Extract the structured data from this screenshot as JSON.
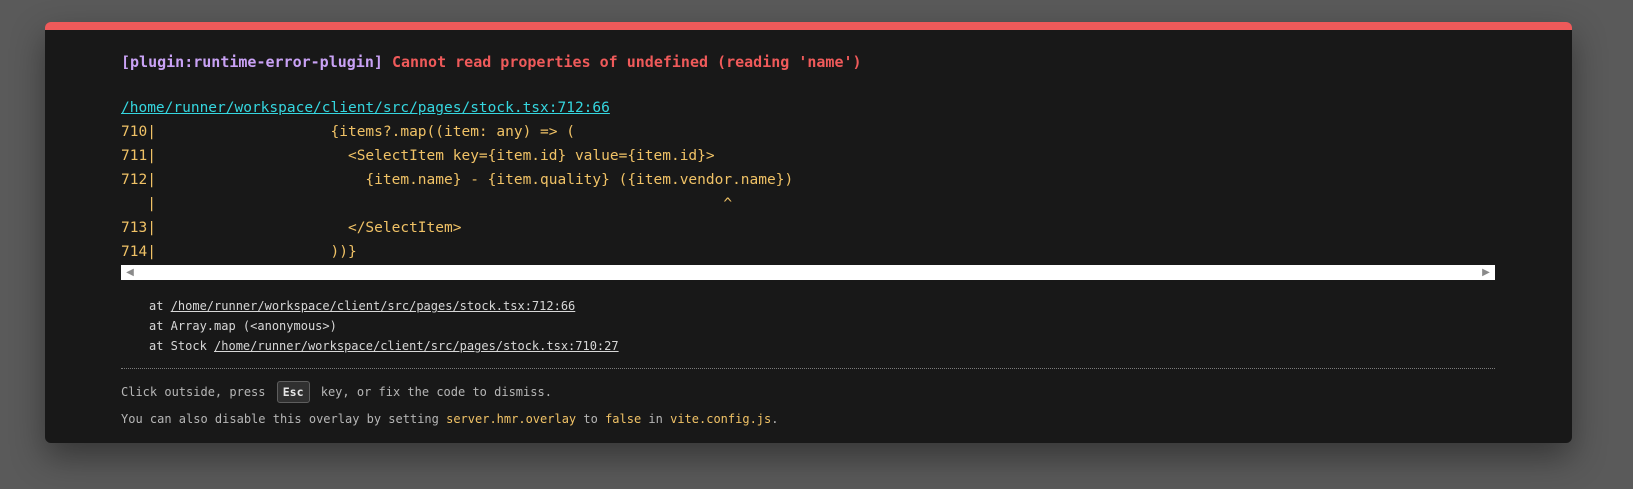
{
  "error": {
    "plugin": "[plugin:runtime-error-plugin]",
    "message": "Cannot read properties of undefined (reading 'name')"
  },
  "file_link": "/home/runner/workspace/client/src/pages/stock.tsx:712:66",
  "code_frame": [
    {
      "text": "710|                    {items?.map((item: any) => ("
    },
    {
      "text": "711|                      <SelectItem key={item.id} value={item.id}>"
    },
    {
      "text": "712|                        {item.name} - {item.quality} ({item.vendor.name})"
    },
    {
      "text": "   |                                                                 ^"
    },
    {
      "text": "713|                      </SelectItem>"
    },
    {
      "text": "714|                    ))}"
    }
  ],
  "scrollbar": {
    "left_arrow": "◀",
    "right_arrow": "▶"
  },
  "stack": [
    {
      "prefix": "at ",
      "link": "/home/runner/workspace/client/src/pages/stock.tsx:712:66"
    },
    {
      "prefix": "at Array.map (<anonymous>)",
      "link": ""
    },
    {
      "prefix": "at Stock ",
      "link": "/home/runner/workspace/client/src/pages/stock.tsx:710:27"
    }
  ],
  "tips": {
    "line1_before": "Click outside, press ",
    "key": "Esc",
    "line1_after": " key, or fix the code to dismiss.",
    "line2_a": "You can also disable this overlay by setting ",
    "line2_code1": "server.hmr.overlay",
    "line2_b": " to ",
    "line2_code2": "false",
    "line2_c": " in ",
    "line2_code3": "vite.config.js",
    "line2_d": "."
  },
  "colors": {
    "accent": "#ef5a5a",
    "plugin": "#c9a2f5",
    "link": "#35d6df",
    "code": "#f0c266",
    "backdrop": "#5a5a5a",
    "panel": "#181818"
  }
}
